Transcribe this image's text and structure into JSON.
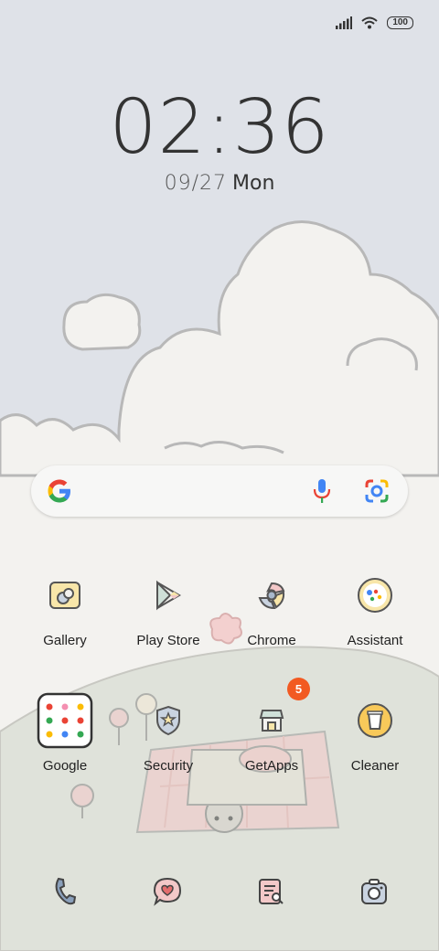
{
  "status_bar": {
    "battery": "100",
    "icons": [
      "signal-icon",
      "wifi-icon",
      "battery-icon"
    ]
  },
  "clock": {
    "time": "02:36",
    "date": "09/27",
    "weekday": "Mon"
  },
  "search_bar": {
    "icons": [
      "google-g-icon",
      "mic-icon",
      "google-lens-icon"
    ]
  },
  "apps_row1": [
    {
      "label": "Gallery"
    },
    {
      "label": "Play Store"
    },
    {
      "label": "Chrome"
    },
    {
      "label": "Assistant"
    }
  ],
  "apps_row2": [
    {
      "label": "Google"
    },
    {
      "label": "Security"
    },
    {
      "label": "GetApps",
      "badge": "5"
    },
    {
      "label": "Cleaner"
    }
  ],
  "dock": [
    "phone-icon",
    "messages-icon",
    "notes-icon",
    "camera-icon"
  ],
  "colors": {
    "sky": "#dfe2e8",
    "ground": "#f3f2ef",
    "hill": "#dfe2da",
    "badge": "#f25a22"
  }
}
